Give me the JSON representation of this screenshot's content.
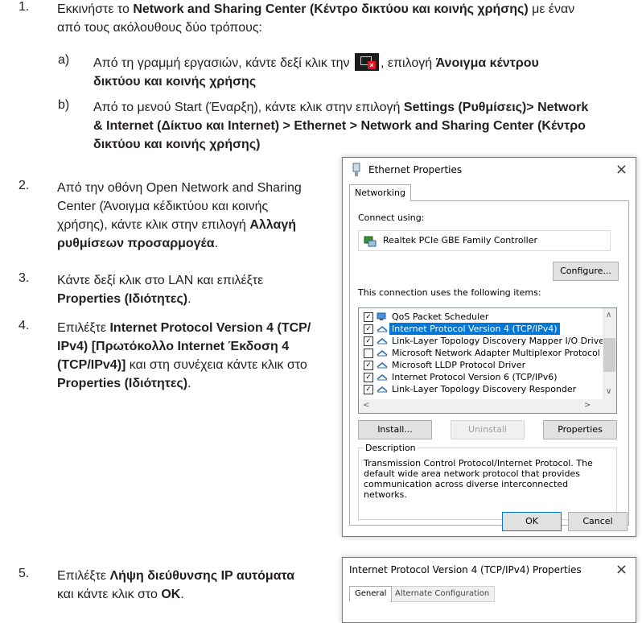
{
  "steps": {
    "s1": {
      "num": "1.",
      "text_a": "Εκκινήστε το ",
      "bold_a": "Network and Sharing Center (Κέντρο δικτύου και κοινής χρήσης)",
      "text_b": " με έναν",
      "line2": "από τους ακόλουθους δύο τρόπους:",
      "sub_a": {
        "label": "a)",
        "text_a": "Από τη γραμμή εργασιών, κάντε δεξί κλικ την ",
        "text_b": ", επιλογή ",
        "bold_a": "Άνοιγμα κέντρου",
        "bold_b": "δικτύου και κοινής χρήσης"
      },
      "sub_b": {
        "label": "b)",
        "text_a": "Από το μενού Start (Έναρξη), κάντε κλικ στην επιλογή ",
        "bold_a": "Settings (Ρυθμίσεις)> Network",
        "bold_b": "& Internet (Δίκτυο και Internet) > Ethernet > Network and Sharing Center (Κέντρο",
        "bold_c": "δικτύου και κοινής χρήσης)"
      }
    },
    "s2": {
      "num": "2.",
      "line1": "Από την οθόνη Open Network and Sharing",
      "line2": "Center (Άνοιγμα κέδικτύου και κοινής",
      "line3": "χρήσης), κάντε κλικ στην επιλογή ",
      "bold_a": "Αλλαγή",
      "bold_b": "ρυθμίσεων προσαρμογέα",
      "end": "."
    },
    "s3": {
      "num": "3.",
      "line1": "Κάντε δεξί κλικ στο LAN και επιλέξτε",
      "bold_a": "Properties (Ιδιότητες)",
      "end": "."
    },
    "s4": {
      "num": "4.",
      "text_a": "Επιλέξτε ",
      "bold_a": "Internet Protocol Version 4 (TCP/",
      "bold_b": "IPv4) [Πρωτόκολλο Internet Έκδοση 4",
      "bold_c": "(TCP/IPv4)]",
      "text_b": " και στη συνέχεια κάντε κλικ στο",
      "bold_d": "Properties (Ιδιότητες)",
      "end": "."
    },
    "s5": {
      "num": "5.",
      "text_a": "Επιλέξτε ",
      "bold_a": "Λήψη διεύθυνσης IP αυτόματα",
      "text_b": "και κάντε κλικ στο ",
      "bold_b": "OK",
      "end": "."
    }
  },
  "dialog1": {
    "title": "Ethernet Properties",
    "close": "×",
    "tab": "Networking",
    "connect_label": "Connect using:",
    "adapter": "Realtek PCIe GBE Family Controller",
    "configure": "Configure...",
    "items_label": "This connection uses the following items:",
    "items": [
      {
        "checked": true,
        "label": "QoS Packet Scheduler",
        "selected": false
      },
      {
        "checked": true,
        "label": "Internet Protocol Version 4 (TCP/IPv4)",
        "selected": true
      },
      {
        "checked": true,
        "label": "Link-Layer Topology Discovery Mapper I/O Driver",
        "selected": false
      },
      {
        "checked": false,
        "label": "Microsoft Network Adapter Multiplexor Protocol",
        "selected": false
      },
      {
        "checked": true,
        "label": "Microsoft LLDP Protocol Driver",
        "selected": false
      },
      {
        "checked": true,
        "label": "Internet Protocol Version 6 (TCP/IPv6)",
        "selected": false
      },
      {
        "checked": true,
        "label": "Link-Layer Topology Discovery Responder",
        "selected": false
      }
    ],
    "install": "Install...",
    "uninstall": "Uninstall",
    "properties": "Properties",
    "description_legend": "Description",
    "description": "Transmission Control Protocol/Internet Protocol. The default wide area network protocol that provides communication across diverse interconnected networks.",
    "ok": "OK",
    "cancel": "Cancel"
  },
  "dialog2": {
    "title": "Internet Protocol Version 4 (TCP/IPv4) Properties",
    "close": "×",
    "tab_general": "General",
    "tab_alternate": "Alternate Configuration"
  }
}
